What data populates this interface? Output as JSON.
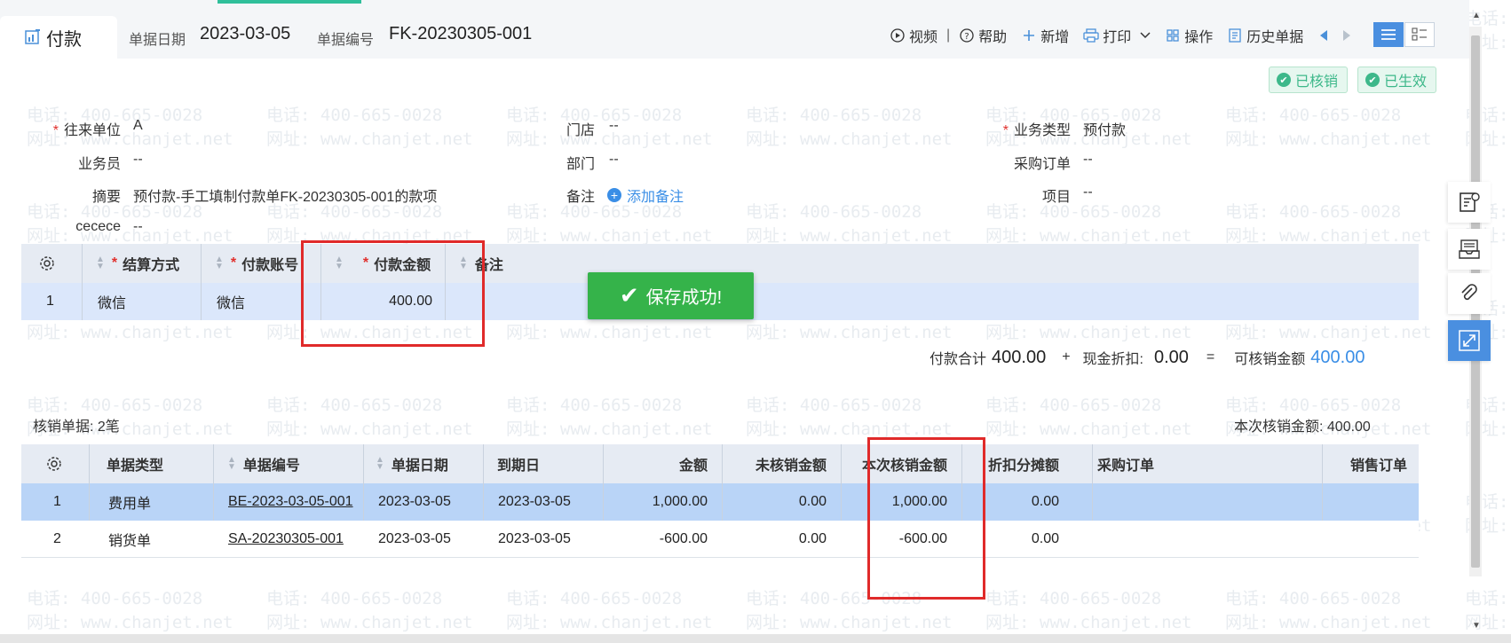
{
  "watermark": {
    "phone": "电话: 400-665-0028",
    "site": "网址: www.chanjet.net"
  },
  "header": {
    "tab_label": "付款",
    "doc_date_label": "单据日期",
    "doc_date": "2023-03-05",
    "doc_no_label": "单据编号",
    "doc_no": "FK-20230305-001"
  },
  "toolbar": {
    "video": "视频",
    "separator": "|",
    "help": "帮助",
    "add": "新增",
    "print": "打印",
    "operate": "操作",
    "history": "历史单据"
  },
  "status": {
    "written_off": "已核销",
    "effective": "已生效"
  },
  "form": {
    "partner_label": "往来单位",
    "partner": "A",
    "store_label": "门店",
    "store": "--",
    "biz_type_label": "业务类型",
    "biz_type": "预付款",
    "salesman_label": "业务员",
    "salesman": "--",
    "dept_label": "部门",
    "dept": "--",
    "po_label": "采购订单",
    "po": "--",
    "summary_label": "摘要",
    "summary": "预付款-手工填制付款单FK-20230305-001的款项",
    "remark_label": "备注",
    "add_remark": "添加备注",
    "project_label": "项目",
    "project": "--",
    "custom_label": "cecece",
    "custom": "--",
    "required_mark": "*"
  },
  "payment_table": {
    "headers": [
      "结算方式",
      "付款账号",
      "付款金额",
      "备注"
    ],
    "rows": [
      {
        "no": "1",
        "method": "微信",
        "account": "微信",
        "amount": "400.00",
        "note": ""
      }
    ]
  },
  "toast": "保存成功!",
  "totals": {
    "pay_total_label": "付款合计",
    "pay_total": "400.00",
    "plus": "+",
    "discount_label": "现金折扣:",
    "discount": "0.00",
    "equals": "=",
    "writeoff_avail_label": "可核销金额",
    "writeoff_avail": "400.00"
  },
  "writeoff": {
    "count_label": "核销单据: 2笔",
    "amount_label": "本次核销金额: 400.00",
    "headers": [
      "单据类型",
      "单据编号",
      "单据日期",
      "到期日",
      "金额",
      "未核销金额",
      "本次核销金额",
      "折扣分摊额",
      "采购订单",
      "销售订单"
    ],
    "rows": [
      {
        "no": "1",
        "type": "费用单",
        "doc_no": "BE-2023-03-05-001",
        "date": "2023-03-05",
        "due": "2023-03-05",
        "amount": "1,000.00",
        "unwritten": "0.00",
        "this_writeoff": "1,000.00",
        "discount": "0.00",
        "po": "",
        "so": ""
      },
      {
        "no": "2",
        "type": "销货单",
        "doc_no": "SA-20230305-001",
        "date": "2023-03-05",
        "due": "2023-03-05",
        "amount": "-600.00",
        "unwritten": "0.00",
        "this_writeoff": "-600.00",
        "discount": "0.00",
        "po": "",
        "so": ""
      }
    ]
  },
  "colors": {
    "accent": "#3a8ee6",
    "success": "#35b34a",
    "highlight": "#e02a2a",
    "header_bg": "#e6ebf3",
    "selected_row": "#b9d4f7"
  }
}
